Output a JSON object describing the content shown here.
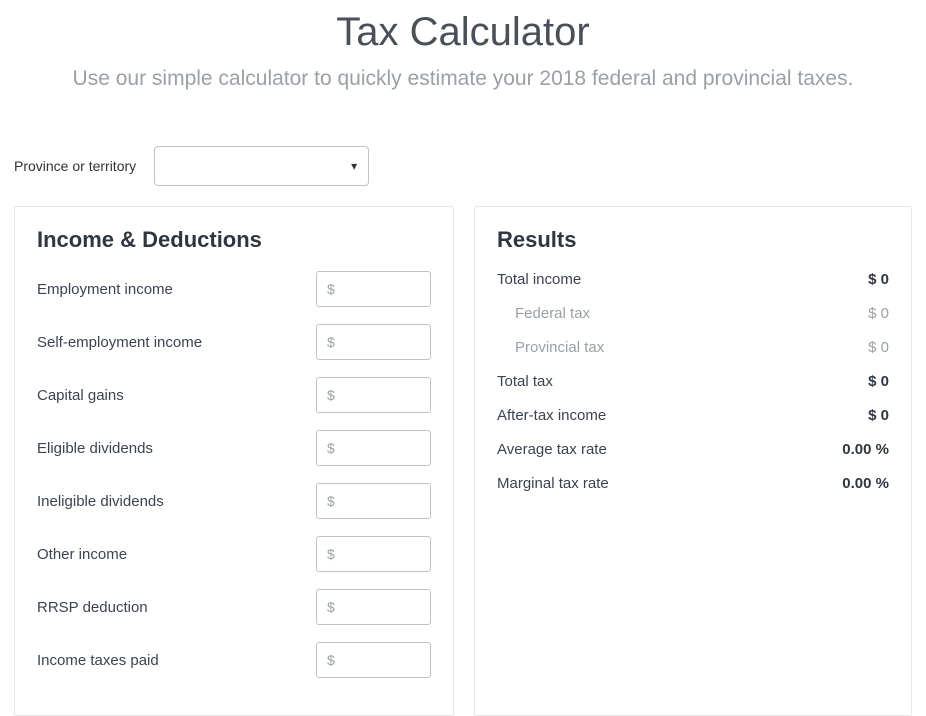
{
  "header": {
    "title": "Tax Calculator",
    "subtitle": "Use our simple calculator to quickly estimate your 2018 federal and provincial taxes."
  },
  "province": {
    "label": "Province or territory",
    "selected": ""
  },
  "income": {
    "title": "Income & Deductions",
    "placeholder": "$",
    "fields": [
      {
        "label": "Employment income",
        "value": ""
      },
      {
        "label": "Self-employment income",
        "value": ""
      },
      {
        "label": "Capital gains",
        "value": ""
      },
      {
        "label": "Eligible dividends",
        "value": ""
      },
      {
        "label": "Ineligible dividends",
        "value": ""
      },
      {
        "label": "Other income",
        "value": ""
      },
      {
        "label": "RRSP deduction",
        "value": ""
      },
      {
        "label": "Income taxes paid",
        "value": ""
      }
    ]
  },
  "results": {
    "title": "Results",
    "rows": [
      {
        "label": "Total income",
        "value": "$ 0",
        "sub": false
      },
      {
        "label": "Federal tax",
        "value": "$ 0",
        "sub": true
      },
      {
        "label": "Provincial tax",
        "value": "$ 0",
        "sub": true
      },
      {
        "label": "Total tax",
        "value": "$ 0",
        "sub": false
      },
      {
        "label": "After-tax income",
        "value": "$ 0",
        "sub": false
      },
      {
        "label": "Average tax rate",
        "value": "0.00 %",
        "sub": false
      },
      {
        "label": "Marginal tax rate",
        "value": "0.00 %",
        "sub": false
      }
    ]
  }
}
